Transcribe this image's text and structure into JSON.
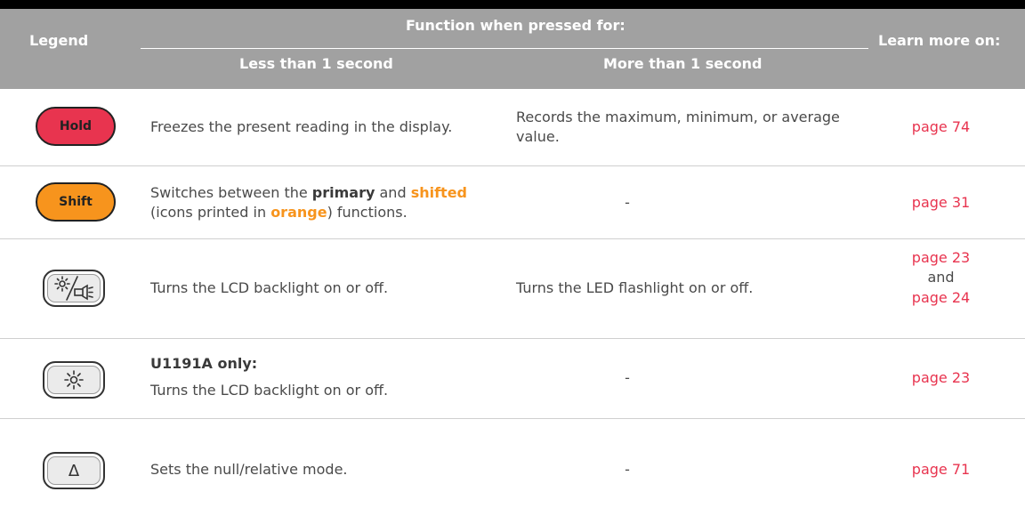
{
  "header": {
    "legend": "Legend",
    "function": "Function when pressed for:",
    "less": "Less than 1 second",
    "more": "More than 1 second",
    "learn": "Learn more on:"
  },
  "rows": [
    {
      "key_label": "Hold",
      "less": "Freezes the present reading in the display.",
      "more": "Records the maximum, minimum, or average value.",
      "link": "page 74"
    },
    {
      "key_label": "Shift",
      "less_parts": [
        "Switches between the ",
        "primary",
        " and ",
        "shifted",
        "(icons printed in ",
        "orange",
        ") functions."
      ],
      "more": "-",
      "link": "page 31"
    },
    {
      "key_icon": "backlight-flashlight-icon",
      "less": "Turns the LCD backlight on or off.",
      "more": "Turns the LED flashlight on or off.",
      "link1": "page 23",
      "link_and": "and",
      "link2": "page 24"
    },
    {
      "key_icon": "backlight-icon",
      "less_title": "U1191A only:",
      "less": "Turns the LCD backlight on or off.",
      "more": "-",
      "link": "page 23"
    },
    {
      "key_icon": "delta-icon",
      "less": "Sets the null/relative mode.",
      "more": "-",
      "link": "page 71"
    }
  ],
  "colors": {
    "header_bg": "#a1a1a1",
    "hold_red": "#e8344f",
    "shift_orange": "#f7941d",
    "link": "#e8344f"
  }
}
